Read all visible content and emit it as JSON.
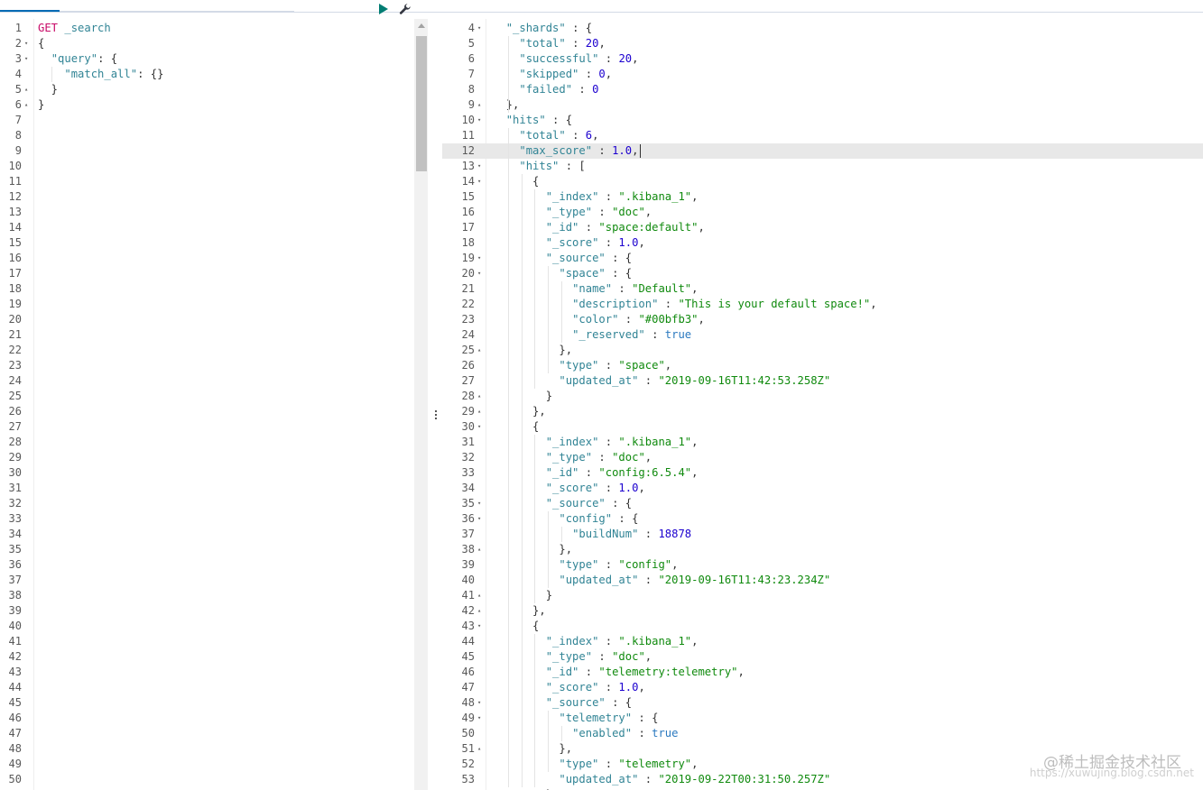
{
  "request_editor": {
    "line_count": 50,
    "lines": [
      [
        {
          "t": "method",
          "v": "GET"
        },
        {
          "t": "punc",
          "v": " "
        },
        {
          "t": "url",
          "v": "_search"
        }
      ],
      [
        {
          "t": "punc",
          "v": "{"
        }
      ],
      [
        {
          "t": "punc",
          "v": "  "
        },
        {
          "t": "key",
          "v": "\"query\""
        },
        {
          "t": "punc",
          "v": ": {"
        }
      ],
      [
        {
          "t": "punc",
          "v": "    "
        },
        {
          "t": "key",
          "v": "\"match_all\""
        },
        {
          "t": "punc",
          "v": ": {}"
        }
      ],
      [
        {
          "t": "punc",
          "v": "  }"
        }
      ],
      [
        {
          "t": "punc",
          "v": "}"
        }
      ]
    ],
    "fold_markers": {
      "2": "down",
      "3": "down",
      "5": "up",
      "6": "up"
    },
    "run_icon": "play-icon",
    "settings_icon": "wrench-icon"
  },
  "response_editor": {
    "first_line": 4,
    "highlighted_line": 12,
    "lines": [
      [
        {
          "t": "punc",
          "v": "  "
        },
        {
          "t": "key",
          "v": "\"_shards\""
        },
        {
          "t": "punc",
          "v": " : {"
        }
      ],
      [
        {
          "t": "punc",
          "v": "    "
        },
        {
          "t": "key",
          "v": "\"total\""
        },
        {
          "t": "punc",
          "v": " : "
        },
        {
          "t": "num",
          "v": "20"
        },
        {
          "t": "punc",
          "v": ","
        }
      ],
      [
        {
          "t": "punc",
          "v": "    "
        },
        {
          "t": "key",
          "v": "\"successful\""
        },
        {
          "t": "punc",
          "v": " : "
        },
        {
          "t": "num",
          "v": "20"
        },
        {
          "t": "punc",
          "v": ","
        }
      ],
      [
        {
          "t": "punc",
          "v": "    "
        },
        {
          "t": "key",
          "v": "\"skipped\""
        },
        {
          "t": "punc",
          "v": " : "
        },
        {
          "t": "num",
          "v": "0"
        },
        {
          "t": "punc",
          "v": ","
        }
      ],
      [
        {
          "t": "punc",
          "v": "    "
        },
        {
          "t": "key",
          "v": "\"failed\""
        },
        {
          "t": "punc",
          "v": " : "
        },
        {
          "t": "num",
          "v": "0"
        }
      ],
      [
        {
          "t": "punc",
          "v": "  },"
        }
      ],
      [
        {
          "t": "punc",
          "v": "  "
        },
        {
          "t": "key",
          "v": "\"hits\""
        },
        {
          "t": "punc",
          "v": " : {"
        }
      ],
      [
        {
          "t": "punc",
          "v": "    "
        },
        {
          "t": "key",
          "v": "\"total\""
        },
        {
          "t": "punc",
          "v": " : "
        },
        {
          "t": "num",
          "v": "6"
        },
        {
          "t": "punc",
          "v": ","
        }
      ],
      [
        {
          "t": "punc",
          "v": "    "
        },
        {
          "t": "key",
          "v": "\"max_score\""
        },
        {
          "t": "punc",
          "v": " : "
        },
        {
          "t": "num",
          "v": "1.0"
        },
        {
          "t": "punc",
          "v": ","
        }
      ],
      [
        {
          "t": "punc",
          "v": "    "
        },
        {
          "t": "key",
          "v": "\"hits\""
        },
        {
          "t": "punc",
          "v": " : ["
        }
      ],
      [
        {
          "t": "punc",
          "v": "      {"
        }
      ],
      [
        {
          "t": "punc",
          "v": "        "
        },
        {
          "t": "key",
          "v": "\"_index\""
        },
        {
          "t": "punc",
          "v": " : "
        },
        {
          "t": "str",
          "v": "\".kibana_1\""
        },
        {
          "t": "punc",
          "v": ","
        }
      ],
      [
        {
          "t": "punc",
          "v": "        "
        },
        {
          "t": "key",
          "v": "\"_type\""
        },
        {
          "t": "punc",
          "v": " : "
        },
        {
          "t": "str",
          "v": "\"doc\""
        },
        {
          "t": "punc",
          "v": ","
        }
      ],
      [
        {
          "t": "punc",
          "v": "        "
        },
        {
          "t": "key",
          "v": "\"_id\""
        },
        {
          "t": "punc",
          "v": " : "
        },
        {
          "t": "str",
          "v": "\"space:default\""
        },
        {
          "t": "punc",
          "v": ","
        }
      ],
      [
        {
          "t": "punc",
          "v": "        "
        },
        {
          "t": "key",
          "v": "\"_score\""
        },
        {
          "t": "punc",
          "v": " : "
        },
        {
          "t": "num",
          "v": "1.0"
        },
        {
          "t": "punc",
          "v": ","
        }
      ],
      [
        {
          "t": "punc",
          "v": "        "
        },
        {
          "t": "key",
          "v": "\"_source\""
        },
        {
          "t": "punc",
          "v": " : {"
        }
      ],
      [
        {
          "t": "punc",
          "v": "          "
        },
        {
          "t": "key",
          "v": "\"space\""
        },
        {
          "t": "punc",
          "v": " : {"
        }
      ],
      [
        {
          "t": "punc",
          "v": "            "
        },
        {
          "t": "key",
          "v": "\"name\""
        },
        {
          "t": "punc",
          "v": " : "
        },
        {
          "t": "str",
          "v": "\"Default\""
        },
        {
          "t": "punc",
          "v": ","
        }
      ],
      [
        {
          "t": "punc",
          "v": "            "
        },
        {
          "t": "key",
          "v": "\"description\""
        },
        {
          "t": "punc",
          "v": " : "
        },
        {
          "t": "str",
          "v": "\"This is your default space!\""
        },
        {
          "t": "punc",
          "v": ","
        }
      ],
      [
        {
          "t": "punc",
          "v": "            "
        },
        {
          "t": "key",
          "v": "\"color\""
        },
        {
          "t": "punc",
          "v": " : "
        },
        {
          "t": "str",
          "v": "\"#00bfb3\""
        },
        {
          "t": "punc",
          "v": ","
        }
      ],
      [
        {
          "t": "punc",
          "v": "            "
        },
        {
          "t": "key",
          "v": "\"_reserved\""
        },
        {
          "t": "punc",
          "v": " : "
        },
        {
          "t": "bool",
          "v": "true"
        }
      ],
      [
        {
          "t": "punc",
          "v": "          },"
        }
      ],
      [
        {
          "t": "punc",
          "v": "          "
        },
        {
          "t": "key",
          "v": "\"type\""
        },
        {
          "t": "punc",
          "v": " : "
        },
        {
          "t": "str",
          "v": "\"space\""
        },
        {
          "t": "punc",
          "v": ","
        }
      ],
      [
        {
          "t": "punc",
          "v": "          "
        },
        {
          "t": "key",
          "v": "\"updated_at\""
        },
        {
          "t": "punc",
          "v": " : "
        },
        {
          "t": "str",
          "v": "\"2019-09-16T11:42:53.258Z\""
        }
      ],
      [
        {
          "t": "punc",
          "v": "        }"
        }
      ],
      [
        {
          "t": "punc",
          "v": "      },"
        }
      ],
      [
        {
          "t": "punc",
          "v": "      {"
        }
      ],
      [
        {
          "t": "punc",
          "v": "        "
        },
        {
          "t": "key",
          "v": "\"_index\""
        },
        {
          "t": "punc",
          "v": " : "
        },
        {
          "t": "str",
          "v": "\".kibana_1\""
        },
        {
          "t": "punc",
          "v": ","
        }
      ],
      [
        {
          "t": "punc",
          "v": "        "
        },
        {
          "t": "key",
          "v": "\"_type\""
        },
        {
          "t": "punc",
          "v": " : "
        },
        {
          "t": "str",
          "v": "\"doc\""
        },
        {
          "t": "punc",
          "v": ","
        }
      ],
      [
        {
          "t": "punc",
          "v": "        "
        },
        {
          "t": "key",
          "v": "\"_id\""
        },
        {
          "t": "punc",
          "v": " : "
        },
        {
          "t": "str",
          "v": "\"config:6.5.4\""
        },
        {
          "t": "punc",
          "v": ","
        }
      ],
      [
        {
          "t": "punc",
          "v": "        "
        },
        {
          "t": "key",
          "v": "\"_score\""
        },
        {
          "t": "punc",
          "v": " : "
        },
        {
          "t": "num",
          "v": "1.0"
        },
        {
          "t": "punc",
          "v": ","
        }
      ],
      [
        {
          "t": "punc",
          "v": "        "
        },
        {
          "t": "key",
          "v": "\"_source\""
        },
        {
          "t": "punc",
          "v": " : {"
        }
      ],
      [
        {
          "t": "punc",
          "v": "          "
        },
        {
          "t": "key",
          "v": "\"config\""
        },
        {
          "t": "punc",
          "v": " : {"
        }
      ],
      [
        {
          "t": "punc",
          "v": "            "
        },
        {
          "t": "key",
          "v": "\"buildNum\""
        },
        {
          "t": "punc",
          "v": " : "
        },
        {
          "t": "num",
          "v": "18878"
        }
      ],
      [
        {
          "t": "punc",
          "v": "          },"
        }
      ],
      [
        {
          "t": "punc",
          "v": "          "
        },
        {
          "t": "key",
          "v": "\"type\""
        },
        {
          "t": "punc",
          "v": " : "
        },
        {
          "t": "str",
          "v": "\"config\""
        },
        {
          "t": "punc",
          "v": ","
        }
      ],
      [
        {
          "t": "punc",
          "v": "          "
        },
        {
          "t": "key",
          "v": "\"updated_at\""
        },
        {
          "t": "punc",
          "v": " : "
        },
        {
          "t": "str",
          "v": "\"2019-09-16T11:43:23.234Z\""
        }
      ],
      [
        {
          "t": "punc",
          "v": "        }"
        }
      ],
      [
        {
          "t": "punc",
          "v": "      },"
        }
      ],
      [
        {
          "t": "punc",
          "v": "      {"
        }
      ],
      [
        {
          "t": "punc",
          "v": "        "
        },
        {
          "t": "key",
          "v": "\"_index\""
        },
        {
          "t": "punc",
          "v": " : "
        },
        {
          "t": "str",
          "v": "\".kibana_1\""
        },
        {
          "t": "punc",
          "v": ","
        }
      ],
      [
        {
          "t": "punc",
          "v": "        "
        },
        {
          "t": "key",
          "v": "\"_type\""
        },
        {
          "t": "punc",
          "v": " : "
        },
        {
          "t": "str",
          "v": "\"doc\""
        },
        {
          "t": "punc",
          "v": ","
        }
      ],
      [
        {
          "t": "punc",
          "v": "        "
        },
        {
          "t": "key",
          "v": "\"_id\""
        },
        {
          "t": "punc",
          "v": " : "
        },
        {
          "t": "str",
          "v": "\"telemetry:telemetry\""
        },
        {
          "t": "punc",
          "v": ","
        }
      ],
      [
        {
          "t": "punc",
          "v": "        "
        },
        {
          "t": "key",
          "v": "\"_score\""
        },
        {
          "t": "punc",
          "v": " : "
        },
        {
          "t": "num",
          "v": "1.0"
        },
        {
          "t": "punc",
          "v": ","
        }
      ],
      [
        {
          "t": "punc",
          "v": "        "
        },
        {
          "t": "key",
          "v": "\"_source\""
        },
        {
          "t": "punc",
          "v": " : {"
        }
      ],
      [
        {
          "t": "punc",
          "v": "          "
        },
        {
          "t": "key",
          "v": "\"telemetry\""
        },
        {
          "t": "punc",
          "v": " : {"
        }
      ],
      [
        {
          "t": "punc",
          "v": "            "
        },
        {
          "t": "key",
          "v": "\"enabled\""
        },
        {
          "t": "punc",
          "v": " : "
        },
        {
          "t": "bool",
          "v": "true"
        }
      ],
      [
        {
          "t": "punc",
          "v": "          },"
        }
      ],
      [
        {
          "t": "punc",
          "v": "          "
        },
        {
          "t": "key",
          "v": "\"type\""
        },
        {
          "t": "punc",
          "v": " : "
        },
        {
          "t": "str",
          "v": "\"telemetry\""
        },
        {
          "t": "punc",
          "v": ","
        }
      ],
      [
        {
          "t": "punc",
          "v": "          "
        },
        {
          "t": "key",
          "v": "\"updated_at\""
        },
        {
          "t": "punc",
          "v": " : "
        },
        {
          "t": "str",
          "v": "\"2019-09-22T00:31:50.257Z\""
        }
      ],
      [
        {
          "t": "punc",
          "v": "        }"
        }
      ]
    ],
    "fold_markers": {
      "4": "down",
      "9": "up",
      "10": "down",
      "13": "down",
      "14": "down",
      "19": "down",
      "20": "down",
      "25": "up",
      "28": "up",
      "29": "up",
      "30": "down",
      "35": "down",
      "36": "down",
      "38": "up",
      "41": "up",
      "42": "up",
      "43": "down",
      "48": "down",
      "49": "down",
      "51": "up"
    }
  },
  "watermark": {
    "text": "@稀土掘金技术社区",
    "url": "https://xuwujing.blog.csdn.net"
  },
  "colors": {
    "method": "#c80a68",
    "url": "#318495",
    "key": "#318495",
    "string": "#108a0e",
    "number": "#1c00cf",
    "boolean": "#2c7ac0",
    "run_button": "#017d73",
    "tab_accent": "#006bb4"
  }
}
